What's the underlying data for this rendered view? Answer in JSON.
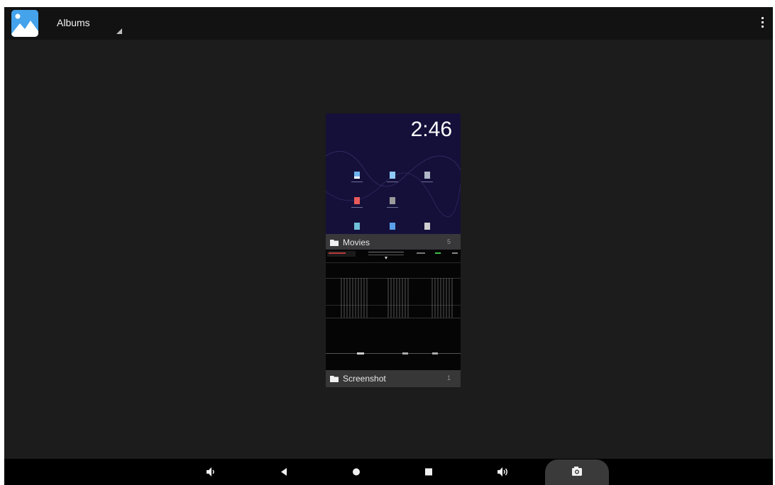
{
  "action_bar": {
    "title": "Albums",
    "app_icon": "gallery-icon",
    "overflow_icon": "more-vert-icon",
    "spinner_icon": "spinner-triangle-icon"
  },
  "albums": [
    {
      "name": "Movies",
      "count": "5",
      "folder_icon": "folder-icon",
      "thumbnail": {
        "clock": "2:46"
      }
    },
    {
      "name": "Screenshot",
      "count": "1",
      "folder_icon": "folder-icon"
    }
  ],
  "nav_bar": {
    "buttons": [
      {
        "name": "volume-down",
        "icon": "volume-down-icon"
      },
      {
        "name": "back",
        "icon": "back-triangle-icon"
      },
      {
        "name": "home",
        "icon": "home-circle-icon"
      },
      {
        "name": "recents",
        "icon": "recents-square-icon"
      },
      {
        "name": "volume-up",
        "icon": "volume-up-icon"
      },
      {
        "name": "screenshot",
        "icon": "camera-icon"
      }
    ]
  },
  "colors": {
    "background": "#1c1c1c",
    "action_bar": "#121212",
    "nav_bar": "#000000",
    "app_icon": "#3e9ee8",
    "label_overlay": "#3c3c3c"
  }
}
